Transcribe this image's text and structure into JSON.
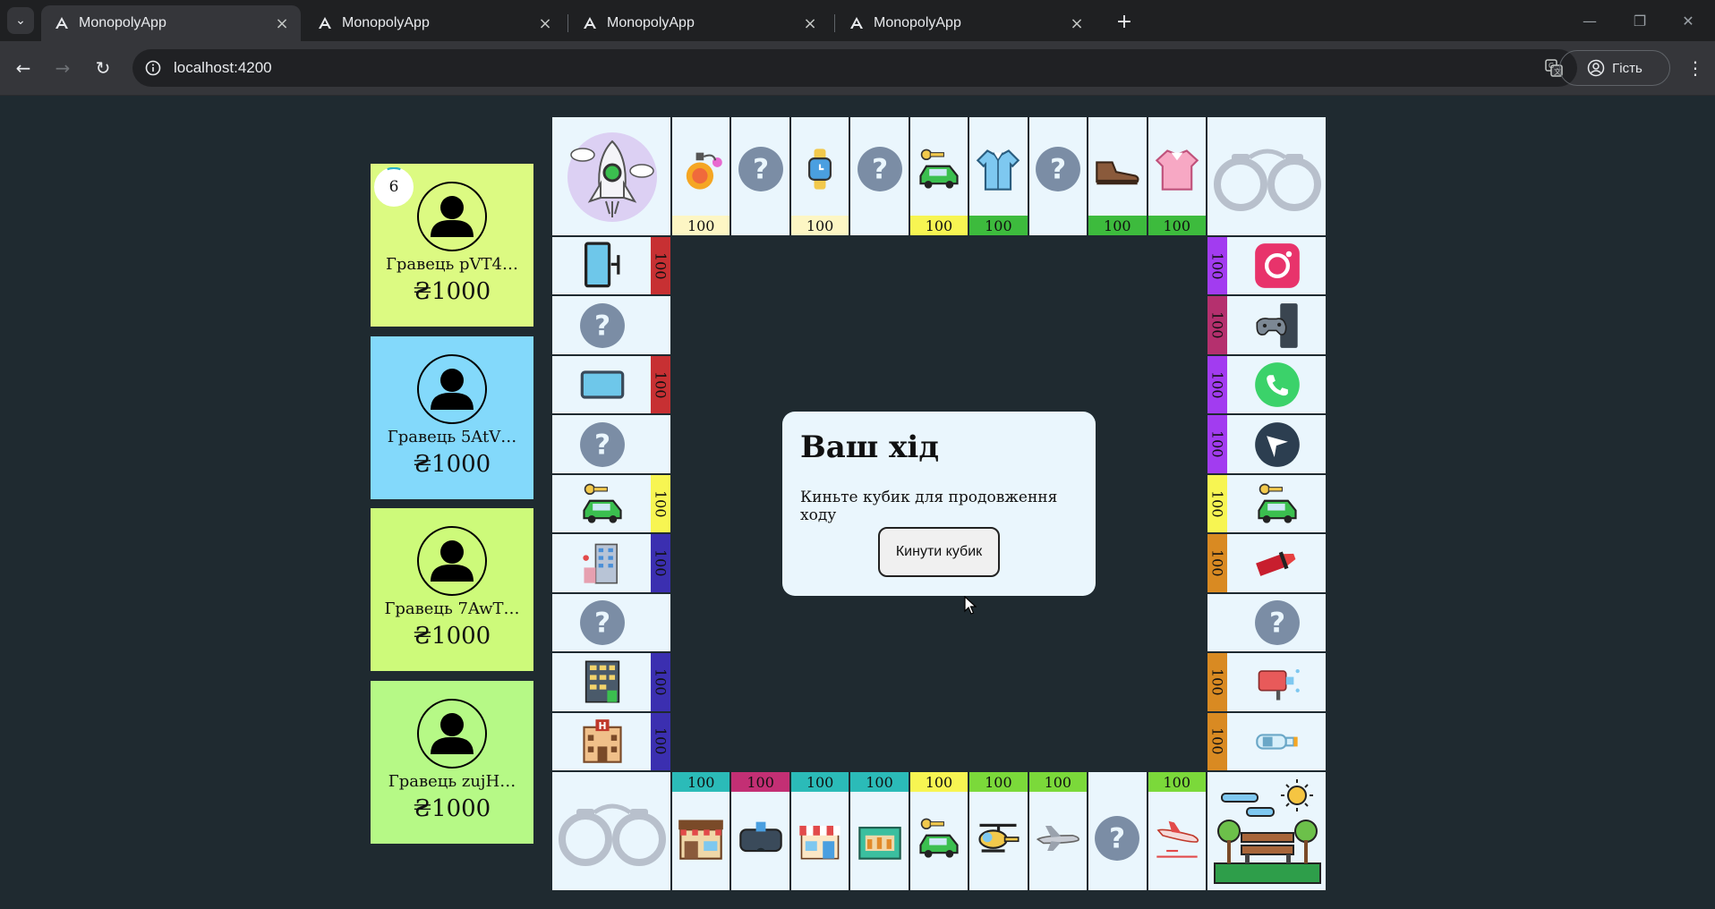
{
  "browser": {
    "tabs": [
      {
        "title": "MonopolyApp",
        "active": true
      },
      {
        "title": "MonopolyApp",
        "active": false
      },
      {
        "title": "MonopolyApp",
        "active": false
      },
      {
        "title": "MonopolyApp",
        "active": false
      }
    ],
    "url": "localhost:4200",
    "profile_label": "Гість"
  },
  "players": [
    {
      "name": "Гравець pVT4…",
      "money": "₴1000",
      "color": "#dcfa82",
      "dice": "6"
    },
    {
      "name": "Гравець 5AtV…",
      "money": "₴1000",
      "color": "#83d9fb"
    },
    {
      "name": "Гравець 7AwT…",
      "money": "₴1000",
      "color": "#cdfa7a"
    },
    {
      "name": "Гравець zujH…",
      "money": "₴1000",
      "color": "#b6f986"
    }
  ],
  "board": {
    "top": [
      {
        "icon": "perfume-icon",
        "price": "100",
        "color": "#fdf6c4"
      },
      {
        "icon": "chance-icon"
      },
      {
        "icon": "smartwatch-icon",
        "price": "100",
        "color": "#fdf6c4"
      },
      {
        "icon": "chance-icon"
      },
      {
        "icon": "car-key-icon",
        "price": "100",
        "color": "#f7f552"
      },
      {
        "icon": "shirt-icon",
        "price": "100",
        "color": "#3dbb3d"
      },
      {
        "icon": "chance-icon"
      },
      {
        "icon": "shoe-icon",
        "price": "100",
        "color": "#3dbb3d"
      },
      {
        "icon": "blouse-icon",
        "price": "100",
        "color": "#3dbb3d"
      }
    ],
    "left": [
      {
        "icon": "monitor-icon",
        "price": "100",
        "color": "#c73033"
      },
      {
        "icon": "chance-icon"
      },
      {
        "icon": "tablet-icon",
        "price": "100",
        "color": "#c73033"
      },
      {
        "icon": "chance-icon"
      },
      {
        "icon": "car-key-icon",
        "price": "100",
        "color": "#f7f552"
      },
      {
        "icon": "hotel-icon",
        "price": "100",
        "color": "#3b2fb0"
      },
      {
        "icon": "chance-icon"
      },
      {
        "icon": "building-icon",
        "price": "100",
        "color": "#3b2fb0"
      },
      {
        "icon": "hotel-h-icon",
        "price": "100",
        "color": "#3b2fb0"
      }
    ],
    "right": [
      {
        "icon": "instagram-icon",
        "price": "100",
        "color": "#a23cf0"
      },
      {
        "icon": "xbox-icon",
        "price": "100",
        "color": "#b5306e"
      },
      {
        "icon": "whatsapp-icon",
        "price": "100",
        "color": "#a23cf0"
      },
      {
        "icon": "messenger-icon",
        "price": "100",
        "color": "#a23cf0"
      },
      {
        "icon": "car-key-icon",
        "price": "100",
        "color": "#f7f552"
      },
      {
        "icon": "lipstick-icon",
        "price": "100",
        "color": "#d98a22"
      },
      {
        "icon": "chance-icon"
      },
      {
        "icon": "spray-icon",
        "price": "100",
        "color": "#d98a22"
      },
      {
        "icon": "bottle-icon",
        "price": "100",
        "color": "#d98a22"
      }
    ],
    "bottom": [
      {
        "icon": "cafe-icon",
        "price": "100",
        "color": "#2bbbb8"
      },
      {
        "icon": "vr-headset-icon",
        "price": "100",
        "color": "#c32f74"
      },
      {
        "icon": "shop-icon",
        "price": "100",
        "color": "#2bbbb8"
      },
      {
        "icon": "market-icon",
        "price": "100",
        "color": "#2bbbb8"
      },
      {
        "icon": "car-key-icon",
        "price": "100",
        "color": "#f7f552"
      },
      {
        "icon": "helicopter-icon",
        "price": "100",
        "color": "#7bd93a"
      },
      {
        "icon": "airplane-icon",
        "price": "100",
        "color": "#7bd93a"
      },
      {
        "icon": "chance-icon"
      },
      {
        "icon": "plane-landing-icon",
        "price": "100",
        "color": "#7bd93a"
      }
    ]
  },
  "modal": {
    "title": "Ваш хід",
    "message": "Киньте кубик для продовження ходу",
    "button": "Кинути кубик"
  }
}
